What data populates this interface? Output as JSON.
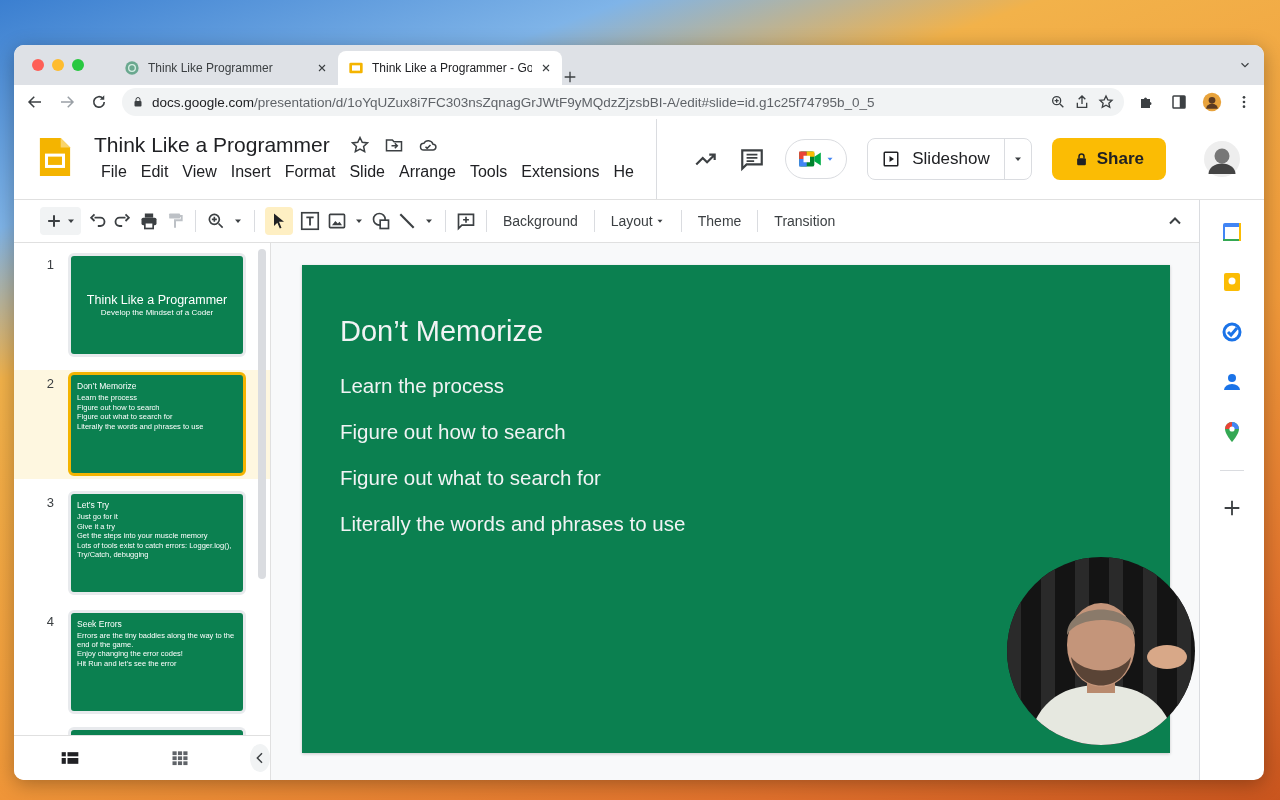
{
  "browser": {
    "tabs": [
      {
        "title": "Think Like Programmer",
        "selected": false
      },
      {
        "title": "Think Like a Programmer - Go",
        "selected": true
      }
    ],
    "address": {
      "host": "docs.google.com",
      "path": "/presentation/d/1oYqUZux8i7FC303nsZqnagGrJWtF9yMQdzZjzsbBI-A/edit#slide=id.g1c25f74795b_0_5"
    }
  },
  "document": {
    "title": "Think Like a Programmer",
    "menu": [
      "File",
      "Edit",
      "View",
      "Insert",
      "Format",
      "Slide",
      "Arrange",
      "Tools",
      "Extensions",
      "He"
    ],
    "slideshow_button": "Slideshow",
    "share_button": "Share"
  },
  "toolbar": {
    "buttons": [
      {
        "label": "Background",
        "dropdown": false
      },
      {
        "label": "Layout",
        "dropdown": true
      },
      {
        "label": "Theme",
        "dropdown": false
      },
      {
        "label": "Transition",
        "dropdown": false
      }
    ]
  },
  "filmstrip": {
    "slides": [
      {
        "number": "1",
        "kind": "title",
        "selected": false,
        "title": "Think Like a Programmer",
        "subtitle": "Develop the Mindset of a Coder"
      },
      {
        "number": "2",
        "kind": "content",
        "selected": true,
        "title": "Don’t Memorize",
        "bullets": [
          "Learn the process",
          "Figure out how to search",
          "Figure out what to search for",
          "Literally the words and phrases to use"
        ]
      },
      {
        "number": "3",
        "kind": "content",
        "selected": false,
        "title": "Let’s Try",
        "bullets": [
          "Just go for it",
          "Give it a try",
          "Get the steps into your muscle memory",
          "Lots of tools exist to catch errors: Logger.log(), Try/Catch, debugging"
        ]
      },
      {
        "number": "4",
        "kind": "content",
        "selected": false,
        "title": "Seek Errors",
        "bullets": [
          "Errors are the tiny baddies along the way to the end of the game.",
          "Enjoy changing the error codes!",
          "Hit Run and let’s see the error"
        ]
      }
    ]
  },
  "slide": {
    "title": "Don’t Memorize",
    "bullets": [
      "Learn the process",
      "Figure out how to search",
      "Figure out what to search for",
      "Literally the words and phrases to use"
    ]
  }
}
